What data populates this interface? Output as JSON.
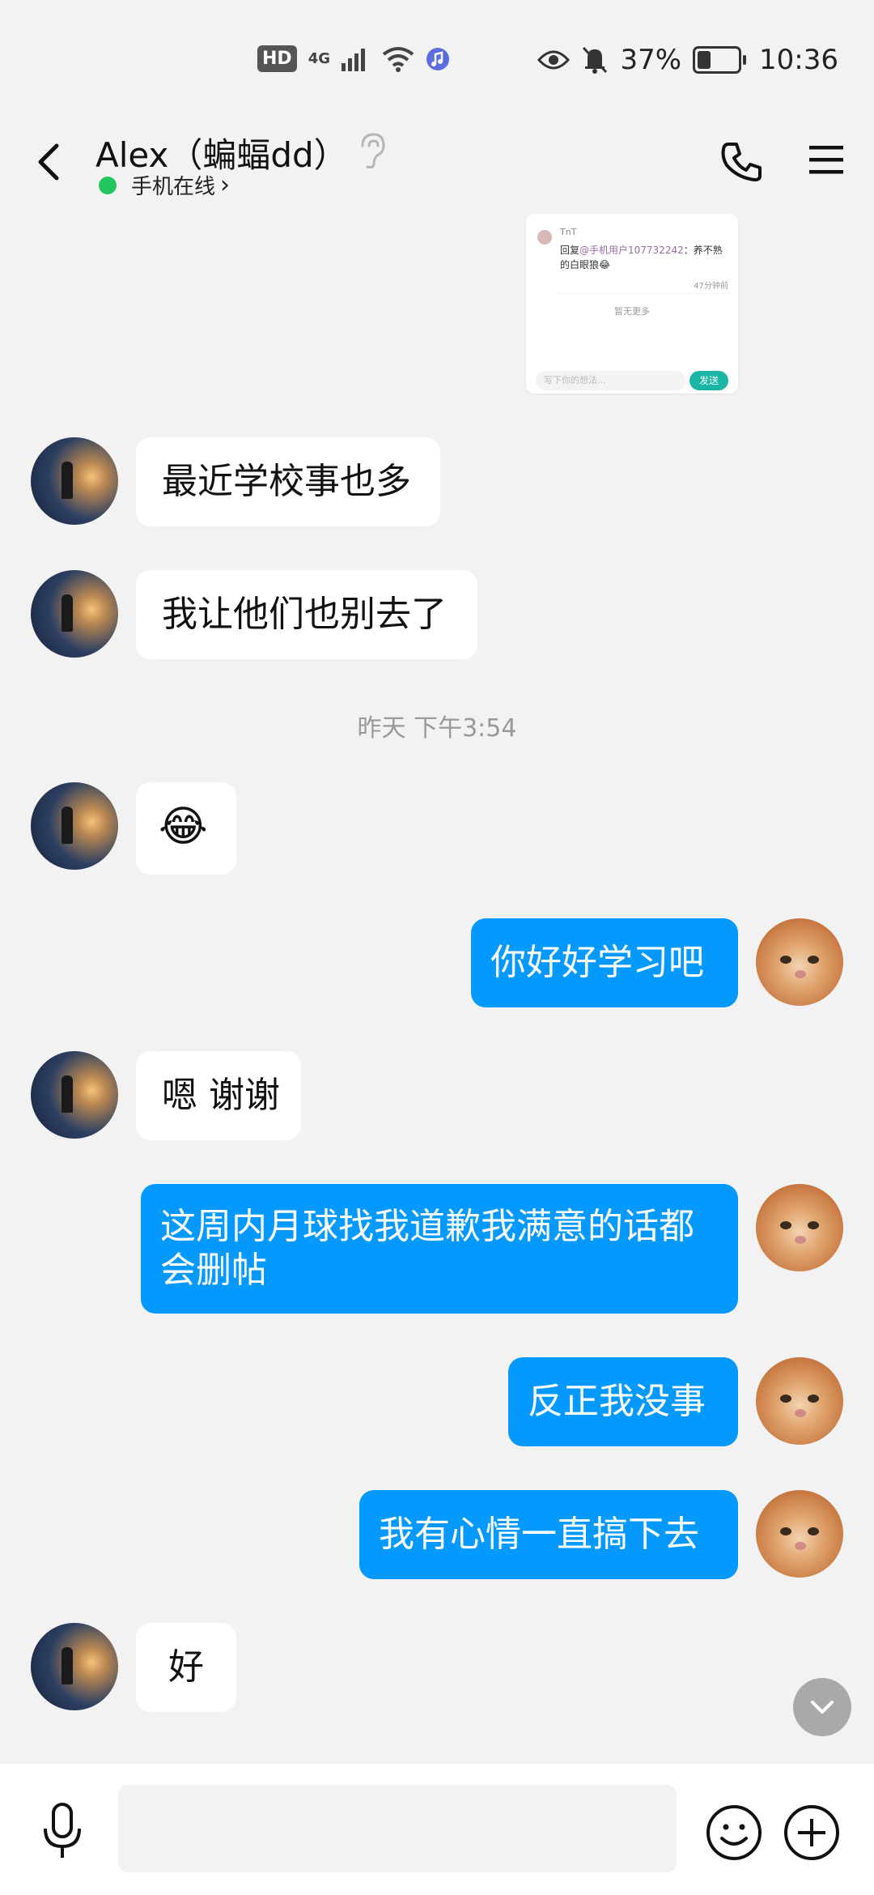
{
  "status_bar": {
    "hd": "HD",
    "network": "4G",
    "battery": "37%",
    "time": "10:36"
  },
  "header": {
    "contact_name": "Alex（蝙蝠dd）",
    "online_status": "手机在线",
    "online_chevron": "›"
  },
  "shared_card": {
    "author": "TnT",
    "reply_prefix": "回复",
    "reply_user": "@手机用户107732242",
    "reply_text": "：养不熟的白眼狼😂",
    "time": "47分钟前",
    "no_more": "暂无更多",
    "placeholder": "写下你的想法...",
    "send": "发送"
  },
  "messages": [
    {
      "side": "in",
      "text": "最近学校事也多"
    },
    {
      "side": "in",
      "text": "我让他们也别去了"
    },
    {
      "side": "in",
      "text": "😂"
    },
    {
      "side": "out",
      "text": "你好好学习吧"
    },
    {
      "side": "in",
      "text": "嗯 谢谢"
    },
    {
      "side": "out",
      "text": "这周内月球找我道歉我满意的话都会删帖"
    },
    {
      "side": "out",
      "text": "反正我没事"
    },
    {
      "side": "out",
      "text": "我有心情一直搞下去"
    },
    {
      "side": "in",
      "text": "好"
    }
  ],
  "timestamp": "昨天 下午3:54",
  "colors": {
    "outgoing_bubble": "#0499ff",
    "incoming_bubble": "#ffffff",
    "background": "#f2f2f2",
    "online_dot": "#22c55e"
  }
}
